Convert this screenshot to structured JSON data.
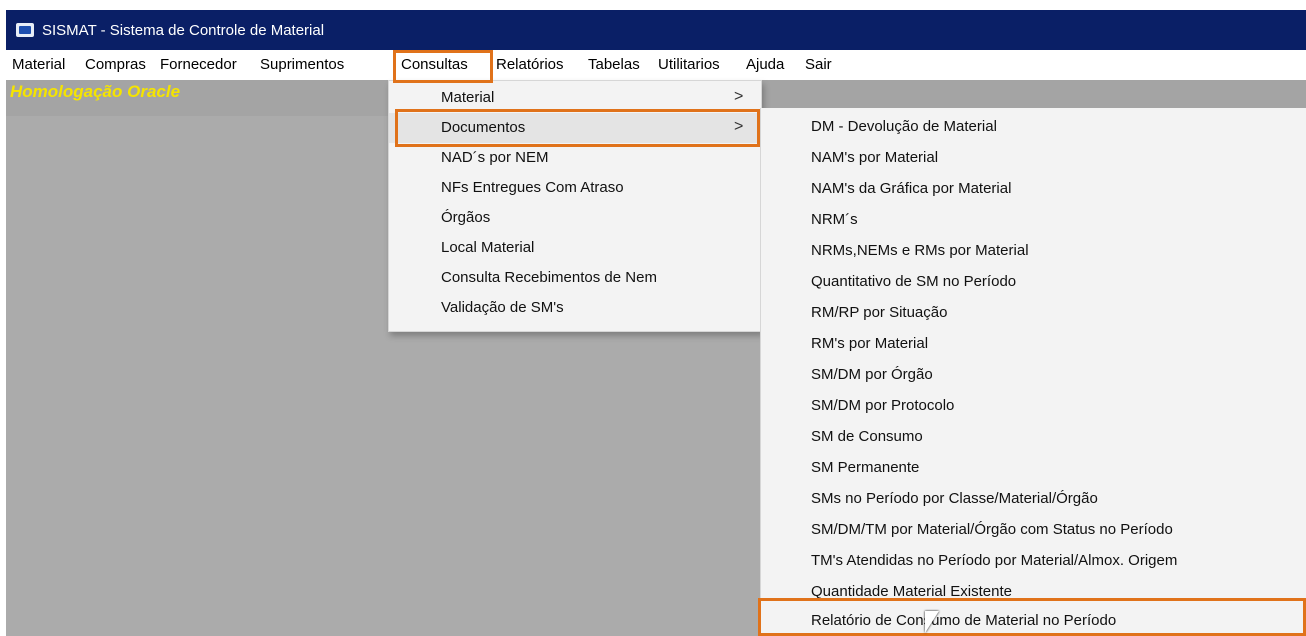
{
  "window": {
    "title": "SISMAT - Sistema de Controle de Material"
  },
  "menubar": {
    "items": [
      "Material",
      "Compras",
      "Fornecedor",
      "Suprimentos",
      "Consultas",
      "Relatórios",
      "Tabelas",
      "Utilitarios",
      "Ajuda",
      "Sair"
    ]
  },
  "workspace": {
    "environment_label": "Homologação Oracle"
  },
  "consultas_menu": {
    "items": [
      {
        "label": "Material",
        "arrow": ">"
      },
      {
        "label": "Documentos",
        "arrow": ">"
      },
      {
        "label": "NAD´s por NEM"
      },
      {
        "label": "NFs Entregues Com Atraso"
      },
      {
        "label": "Órgãos"
      },
      {
        "label": "Local Material"
      },
      {
        "label": "Consulta Recebimentos de Nem"
      },
      {
        "label": "Validação de SM's"
      }
    ]
  },
  "documentos_submenu": {
    "items": [
      "DM - Devolução de Material",
      "NAM's por Material",
      "NAM's da Gráfica por Material",
      "NRM´s",
      "NRMs,NEMs e RMs por Material",
      "Quantitativo de SM no Período",
      "RM/RP por Situação",
      "RM's por Material",
      "SM/DM por Órgão",
      "SM/DM por Protocolo",
      "SM de Consumo",
      "SM Permanente",
      "SMs no Período por Classe/Material/Órgão",
      "SM/DM/TM por Material/Órgão com Status no Período",
      "TM's Atendidas no Período por Material/Almox. Origem",
      "Quantidade Material Existente",
      "Relatório de Consumo de Material no Período"
    ]
  },
  "colors": {
    "titlebar": "#0a1f66",
    "workspace": "#ababab",
    "environment_label": "#f5e400",
    "highlight": "#e0721a",
    "menu_background": "#f3f3f3"
  },
  "icons": {
    "app": "sismat-app-icon",
    "submenu_arrow": "chevron-right-icon",
    "cursor": "mouse-pointer-icon"
  }
}
